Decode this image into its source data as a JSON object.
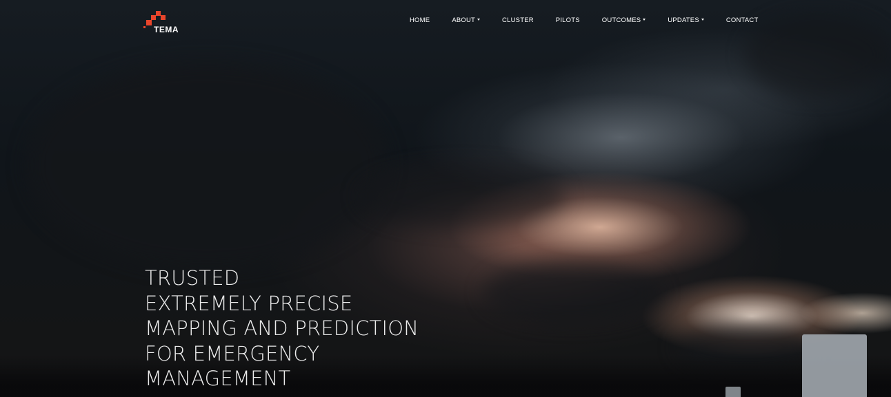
{
  "brand": {
    "name": "TEMA",
    "accent_color": "#e8452b"
  },
  "nav": {
    "items": [
      {
        "label": "HOME",
        "has_dropdown": false
      },
      {
        "label": "ABOUT",
        "has_dropdown": true
      },
      {
        "label": "CLUSTER",
        "has_dropdown": false
      },
      {
        "label": "PILOTS",
        "has_dropdown": false
      },
      {
        "label": "OUTCOMES",
        "has_dropdown": true
      },
      {
        "label": "UPDATES",
        "has_dropdown": true
      },
      {
        "label": "CONTACT",
        "has_dropdown": false
      }
    ]
  },
  "hero": {
    "lines": [
      "TRUSTED",
      "EXTREMELY PRECISE",
      "MAPPING AND PREDICTION",
      "FOR EMERGENCY",
      "MANAGEMENT"
    ]
  }
}
